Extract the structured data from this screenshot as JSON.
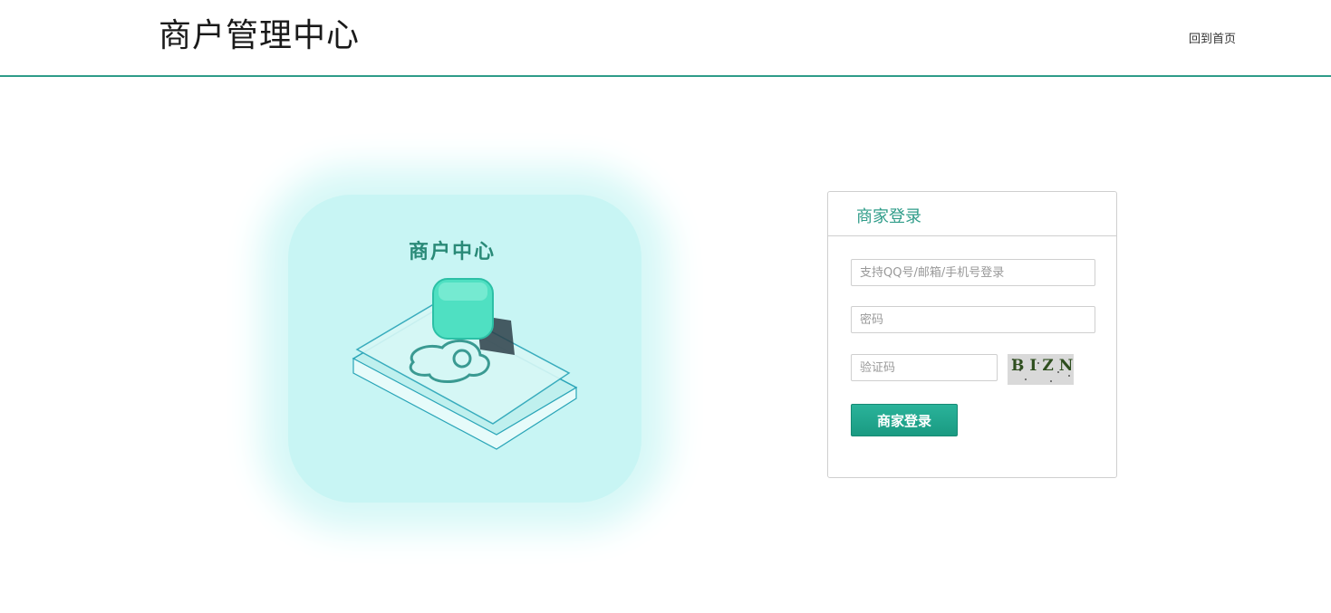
{
  "header": {
    "title": "商户管理中心",
    "home_link": "回到首页"
  },
  "illustration": {
    "title": "商户中心"
  },
  "login": {
    "title": "商家登录",
    "username_placeholder": "支持QQ号/邮箱/手机号登录",
    "password_placeholder": "密码",
    "captcha_placeholder": "验证码",
    "captcha_text": "BIZN",
    "submit_label": "商家登录"
  },
  "colors": {
    "accent": "#2f9c89",
    "button": "#1fa68d",
    "illustration_bg": "#c8f5f4"
  }
}
